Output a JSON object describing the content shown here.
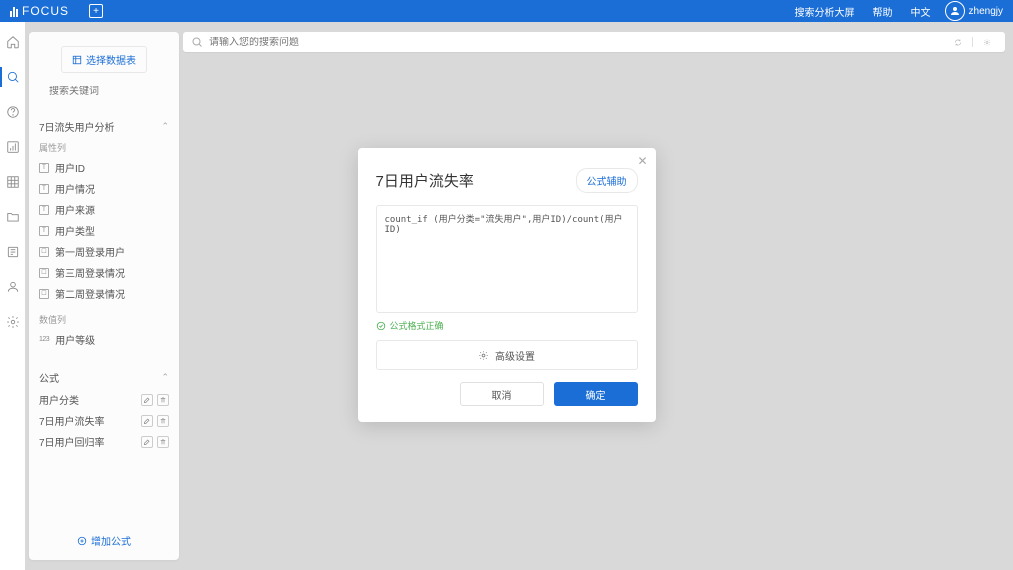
{
  "header": {
    "logo": "FOCUS",
    "link_analysis": "搜索分析大屏",
    "link_help": "帮助",
    "link_lang": "中文",
    "username": "zhengjy"
  },
  "panel": {
    "select_source": "选择数据表",
    "search_placeholder": "搜索关键词",
    "section1_title": "7日流失用户分析",
    "attr_label": "属性列",
    "fields": {
      "f1": "用户ID",
      "f2": "用户情况",
      "f3": "用户来源",
      "f4": "用户类型",
      "f5": "第一周登录用户",
      "f6": "第三周登录情况",
      "f7": "第二周登录情况"
    },
    "num_label": "数值列",
    "num1": "用户等级",
    "formula_label": "公式",
    "formulas": {
      "g1": "用户分类",
      "g2": "7日用户流失率",
      "g3": "7日用户回归率"
    },
    "add_formula": "增加公式"
  },
  "search": {
    "placeholder": "请输入您的搜索问题"
  },
  "modal": {
    "title": "7日用户流失率",
    "help": "公式辅助",
    "formula": "count_if (用户分类=\"流失用户\",用户ID)/count(用户ID)",
    "valid": "公式格式正确",
    "advanced": "高级设置",
    "cancel": "取消",
    "ok": "确定"
  }
}
